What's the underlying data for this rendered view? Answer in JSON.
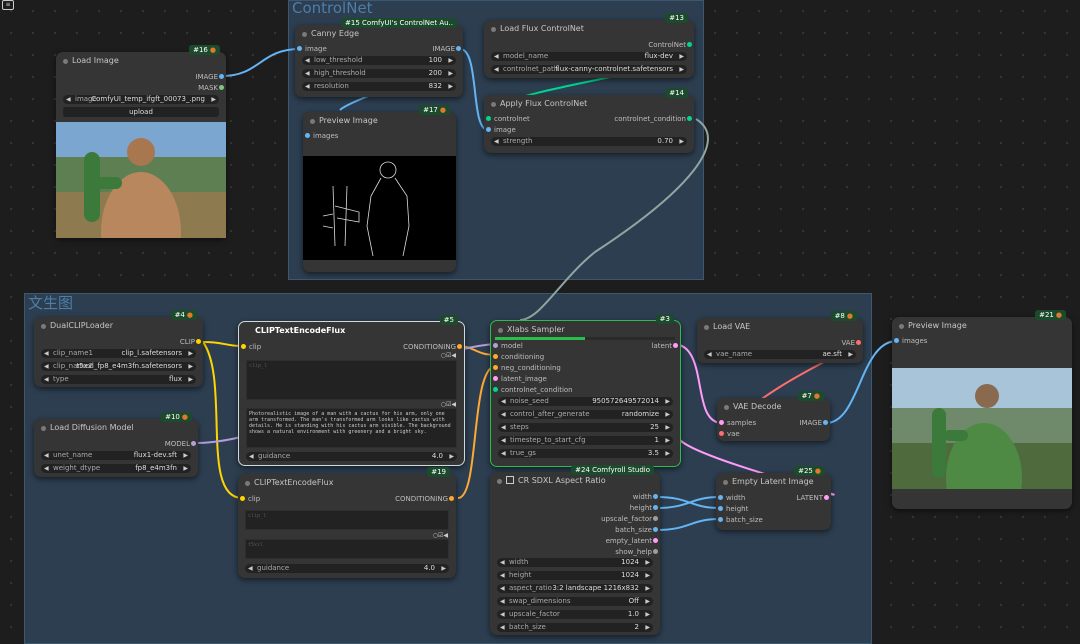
{
  "groups": {
    "controlnet": "ControlNet",
    "main": "文生图"
  },
  "colors": {
    "group_bg": "#2c3e50",
    "node_bg": "#353535",
    "wire_image": "#64b5f6",
    "wire_clip": "#ffd500",
    "wire_conditioning": "#ffa931",
    "wire_model": "#b39ddb",
    "wire_latent": "#ff9cf9",
    "wire_vae": "#ff6e6e",
    "wire_controlnet": "#00d78d",
    "badge_green": "#1c4a2c"
  },
  "nodes": {
    "load_image": {
      "badge": "#16",
      "title": "Load Image",
      "out_image": "IMAGE",
      "out_mask": "MASK",
      "w_image_label": "image",
      "w_image_value": "ComfyUI_temp_ifgft_00073_.png",
      "upload": "upload"
    },
    "canny": {
      "badge": "#15 ComfyUI's ControlNet Au..",
      "title": "Canny Edge",
      "in_image": "image",
      "out_image": "IMAGE",
      "low_label": "low_threshold",
      "low_value": "100",
      "high_label": "high_threshold",
      "high_value": "200",
      "res_label": "resolution",
      "res_value": "832"
    },
    "load_flux_cn": {
      "badge": "#13",
      "title": "Load Flux ControlNet",
      "out": "ControlNet",
      "model_label": "model_name",
      "model_value": "flux-dev",
      "path_label": "controlnet_path",
      "path_value": "flux-canny-controlnet.safetensors"
    },
    "preview_cn": {
      "badge": "#17",
      "title": "Preview Image",
      "in_images": "images"
    },
    "apply_flux_cn": {
      "badge": "#14",
      "title": "Apply Flux ControlNet",
      "in_controlnet": "controlnet",
      "in_image": "image",
      "out": "controlnet_condition",
      "strength_label": "strength",
      "strength_value": "0.70"
    },
    "dualclip": {
      "badge": "#4",
      "title": "DualCLIPLoader",
      "out": "CLIP",
      "c1_label": "clip_name1",
      "c1_value": "clip_l.safetensors",
      "c2_label": "clip_name2",
      "c2_value": "t5xxl_fp8_e4m3fn.safetensors",
      "type_label": "type",
      "type_value": "flux"
    },
    "load_diffusion": {
      "badge": "#10",
      "title": "Load Diffusion Model",
      "out": "MODEL",
      "unet_label": "unet_name",
      "unet_value": "flux1-dev.sft",
      "dtype_label": "weight_dtype",
      "dtype_value": "fp8_e4m3fn"
    },
    "clip_pos": {
      "badge": "#5",
      "title": "CLIPTextEncodeFlux",
      "in_clip": "clip",
      "out": "CONDITIONING",
      "ph1": "clip_l",
      "text2": "Photorealistic image of a man with a cactus for his arm, only one arm transformed. The man's transformed arm looks like cactus with  details. He is standing with his cactus arm visible. The background shows a natural environment with greenery and a bright sky.",
      "guidance_label": "guidance",
      "guidance_value": "4.0"
    },
    "clip_neg": {
      "badge": "#19",
      "title": "CLIPTextEncodeFlux",
      "in_clip": "clip",
      "out": "CONDITIONING",
      "ph1": "clip_l",
      "ph2": "t5xxl",
      "guidance_label": "guidance",
      "guidance_value": "4.0"
    },
    "sampler": {
      "badge": "#3",
      "title": "Xlabs Sampler",
      "in_model": "model",
      "in_cond": "conditioning",
      "in_neg": "neg_conditioning",
      "in_latent": "latent_image",
      "in_cn": "controlnet_condition",
      "out": "latent",
      "seed_label": "noise_seed",
      "seed_value": "950572649572014",
      "cag_label": "control_after_generate",
      "cag_value": "randomize",
      "steps_label": "steps",
      "steps_value": "25",
      "tscfg_label": "timestep_to_start_cfg",
      "tscfg_value": "1",
      "truegs_label": "true_gs",
      "truegs_value": "3.5",
      "progress": 0.5
    },
    "load_vae": {
      "badge": "#8",
      "title": "Load VAE",
      "out": "VAE",
      "vae_label": "vae_name",
      "vae_value": "ae.sft"
    },
    "vae_decode": {
      "badge": "#7",
      "title": "VAE Decode",
      "in_samples": "samples",
      "in_vae": "vae",
      "out": "IMAGE"
    },
    "preview_out": {
      "badge": "#21",
      "title": "Preview Image",
      "in_images": "images"
    },
    "aspect": {
      "badge": "#24 Comfyroll Studio",
      "title": "CR SDXL Aspect Ratio",
      "outs": [
        "width",
        "height",
        "upscale_factor",
        "batch_size",
        "empty_latent",
        "show_help"
      ],
      "widgets": [
        {
          "label": "width",
          "value": "1024"
        },
        {
          "label": "height",
          "value": "1024"
        },
        {
          "label": "aspect_ratio",
          "value": "3:2 landscape 1216x832"
        },
        {
          "label": "swap_dimensions",
          "value": "Off"
        },
        {
          "label": "upscale_factor",
          "value": "1.0"
        },
        {
          "label": "batch_size",
          "value": "2"
        }
      ]
    },
    "empty_latent": {
      "badge": "#25",
      "title": "Empty Latent Image",
      "in_width": "width",
      "in_height": "height",
      "in_batch": "batch_size",
      "out": "LATENT"
    }
  }
}
